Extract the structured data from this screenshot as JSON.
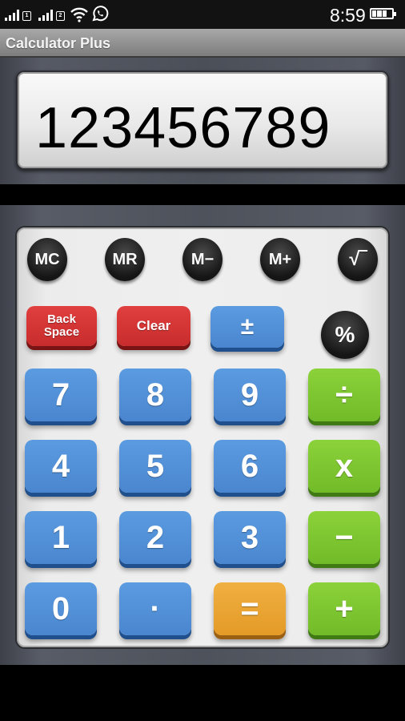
{
  "status_bar": {
    "sim1_label": "1",
    "sim2_label": "2",
    "time": "8:59",
    "icons": [
      "signal-icon",
      "signal-icon",
      "wifi-icon",
      "whatsapp-icon",
      "battery-icon"
    ]
  },
  "app": {
    "title": "Calculator Plus"
  },
  "display": {
    "value": "123456789"
  },
  "memory_row": [
    {
      "label": "MC",
      "name": "mc-button"
    },
    {
      "label": "MR",
      "name": "mr-button"
    },
    {
      "label": "M−",
      "name": "m-minus-button"
    },
    {
      "label": "M+",
      "name": "m-plus-button"
    },
    {
      "label": "√‾",
      "name": "sqrt-button"
    }
  ],
  "function_row": {
    "backspace_line1": "Back",
    "backspace_line2": "Space",
    "clear": "Clear",
    "plus_minus": "±",
    "percent": "%"
  },
  "keys": {
    "k7": "7",
    "k8": "8",
    "k9": "9",
    "divide": "÷",
    "k4": "4",
    "k5": "5",
    "k6": "6",
    "multiply": "x",
    "k1": "1",
    "k2": "2",
    "k3": "3",
    "subtract": "−",
    "k0": "0",
    "decimal": "·",
    "equals": "=",
    "add": "+"
  },
  "colors": {
    "digit_key": "#4f8ed6",
    "operator_key": "#7fc630",
    "equals_key": "#e9a32f",
    "clear_key": "#d43535",
    "memory_key": "#1e1e1e"
  }
}
